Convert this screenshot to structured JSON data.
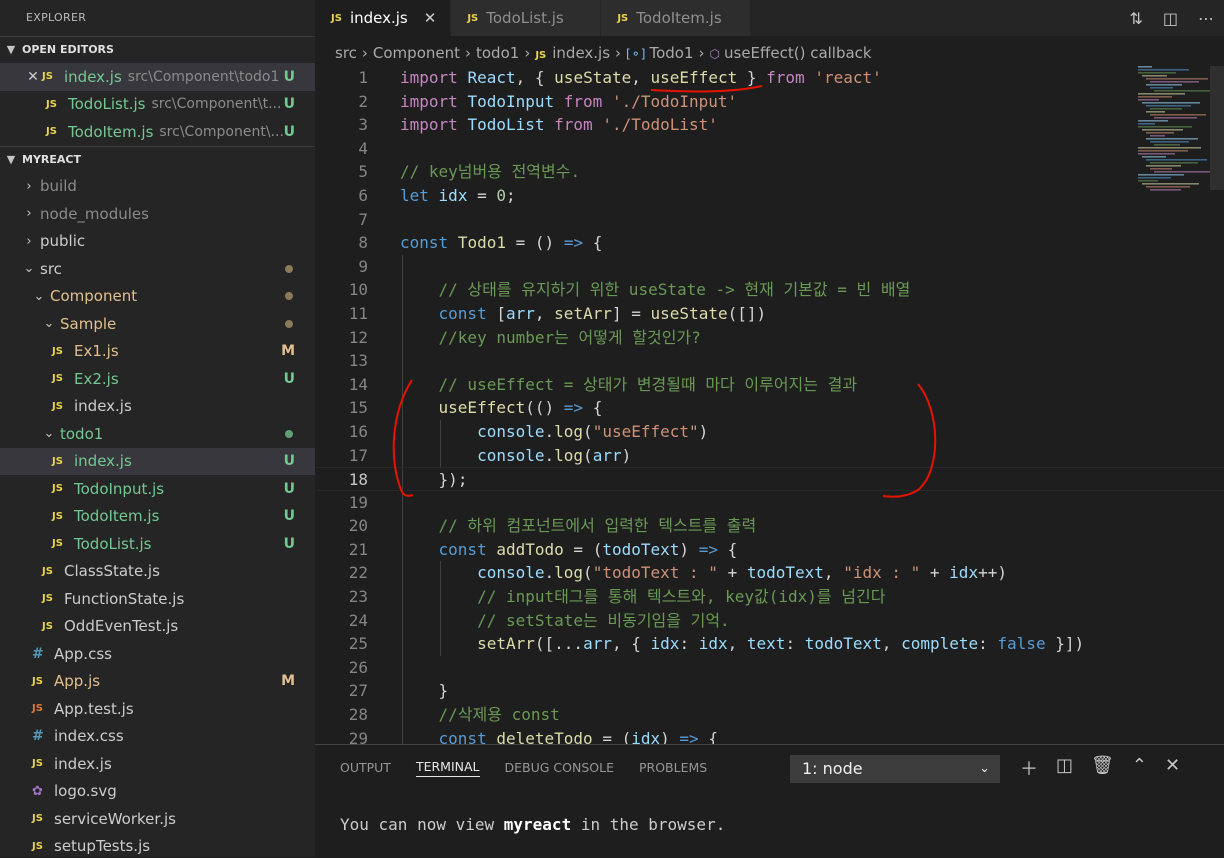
{
  "sidebar": {
    "title": "EXPLORER",
    "open_editors": {
      "label": "OPEN EDITORS",
      "items": [
        {
          "name": "index.js",
          "path": "src\\Component\\todo1",
          "status": "U"
        },
        {
          "name": "TodoList.js",
          "path": "src\\Component\\t...",
          "status": "U"
        },
        {
          "name": "TodoItem.js",
          "path": "src\\Component\\...",
          "status": "U"
        }
      ]
    },
    "project": {
      "label": "MYREACT",
      "tree": [
        {
          "name": "build"
        },
        {
          "name": "node_modules"
        },
        {
          "name": "public"
        },
        {
          "name": "src"
        },
        {
          "name": "Component"
        },
        {
          "name": "Sample"
        },
        {
          "name": "Ex1.js",
          "status": "M"
        },
        {
          "name": "Ex2.js",
          "status": "U"
        },
        {
          "name": "index.js"
        },
        {
          "name": "todo1"
        },
        {
          "name": "index.js",
          "status": "U"
        },
        {
          "name": "TodoInput.js",
          "status": "U"
        },
        {
          "name": "TodoItem.js",
          "status": "U"
        },
        {
          "name": "TodoList.js",
          "status": "U"
        },
        {
          "name": "ClassState.js"
        },
        {
          "name": "FunctionState.js"
        },
        {
          "name": "OddEvenTest.js"
        },
        {
          "name": "App.css"
        },
        {
          "name": "App.js",
          "status": "M"
        },
        {
          "name": "App.test.js"
        },
        {
          "name": "index.css"
        },
        {
          "name": "index.js"
        },
        {
          "name": "logo.svg"
        },
        {
          "name": "serviceWorker.js"
        },
        {
          "name": "setupTests.js"
        }
      ]
    }
  },
  "tabs": [
    {
      "icon": "JS",
      "label": "index.js",
      "active": true
    },
    {
      "icon": "JS",
      "label": "TodoList.js"
    },
    {
      "icon": "JS",
      "label": "TodoItem.js"
    }
  ],
  "breadcrumb": [
    "src",
    "Component",
    "todo1",
    "index.js",
    "Todo1",
    "useEffect() callback"
  ],
  "code_lines": [
    "import React, { useState, useEffect } from 'react'",
    "import TodoInput from './TodoInput'",
    "import TodoList from './TodoList'",
    "",
    "// key넘버용 전역변수.",
    "let idx = 0;",
    "",
    "const Todo1 = () => {",
    "",
    "    // 상태를 유지하기 위한 useState -> 현재 기본값 = 빈 배열",
    "    const [arr, setArr] = useState([])",
    "    //key number는 어떻게 할것인가?",
    "",
    "    // useEffect = 상태가 변경될때 마다 이루어지는 결과",
    "    useEffect(() => {",
    "        console.log(\"useEffect\")",
    "        console.log(arr)",
    "    });",
    "",
    "    // 하위 컴포넌트에서 입력한 텍스트를 출력",
    "    const addTodo = (todoText) => {",
    "        console.log(\"todoText : \" + todoText, \"idx : \" + idx++)",
    "        // input태그를 통해 텍스트와, key값(idx)를 넘긴다",
    "        // setState는 비동기임을 기억.",
    "        setArr([...arr, { idx: idx, text: todoText, complete: false }])",
    "",
    "    }",
    "    //삭제용 const",
    "    const deleteTodo = (idx) => {"
  ],
  "panel": {
    "tabs": [
      "OUTPUT",
      "TERMINAL",
      "DEBUG CONSOLE",
      "PROBLEMS"
    ],
    "active_tab": "TERMINAL",
    "terminal_selector": "1: node",
    "terminal_output": {
      "prefix": "You can now view ",
      "app": "myreact",
      "suffix": " in the browser."
    }
  },
  "colors": {
    "editor_bg": "#1e1e1e",
    "sidebar_bg": "#252526",
    "untracked_green": "#73c991",
    "modified_yellow": "#e2c08d",
    "annotation_red": "#e51400"
  }
}
